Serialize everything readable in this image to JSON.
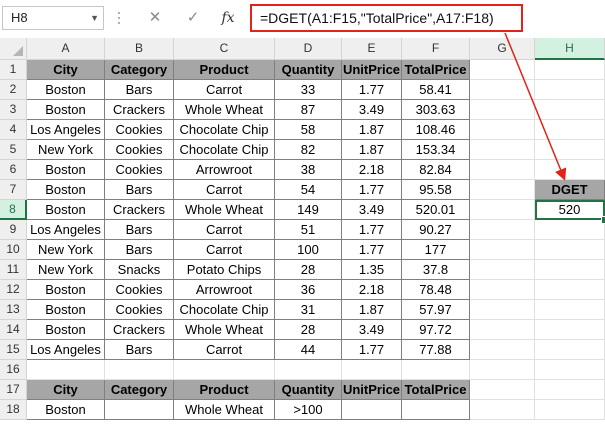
{
  "formula_bar": {
    "name_box": "H8",
    "cancel_icon": "✕",
    "confirm_icon": "✓",
    "fx_label": "fx",
    "formula": "=DGET(A1:F15,\"TotalPrice\",A17:F18)"
  },
  "columns": [
    "A",
    "B",
    "C",
    "D",
    "E",
    "F",
    "G",
    "H"
  ],
  "rows": [
    "1",
    "2",
    "3",
    "4",
    "5",
    "6",
    "7",
    "8",
    "9",
    "10",
    "11",
    "12",
    "13",
    "14",
    "15",
    "16",
    "17",
    "18"
  ],
  "selected": {
    "column": "H",
    "row": "8"
  },
  "accent_colors": {
    "excel_green": "#217346",
    "highlight_red": "#e2231a",
    "header_gray": "#a6a6a6"
  },
  "data_table": {
    "headers": [
      "City",
      "Category",
      "Product",
      "Quantity",
      "UnitPrice",
      "TotalPrice"
    ],
    "rows": [
      [
        "Boston",
        "Bars",
        "Carrot",
        "33",
        "1.77",
        "58.41"
      ],
      [
        "Boston",
        "Crackers",
        "Whole Wheat",
        "87",
        "3.49",
        "303.63"
      ],
      [
        "Los Angeles",
        "Cookies",
        "Chocolate Chip",
        "58",
        "1.87",
        "108.46"
      ],
      [
        "New York",
        "Cookies",
        "Chocolate Chip",
        "82",
        "1.87",
        "153.34"
      ],
      [
        "Boston",
        "Cookies",
        "Arrowroot",
        "38",
        "2.18",
        "82.84"
      ],
      [
        "Boston",
        "Bars",
        "Carrot",
        "54",
        "1.77",
        "95.58"
      ],
      [
        "Boston",
        "Crackers",
        "Whole Wheat",
        "149",
        "3.49",
        "520.01"
      ],
      [
        "Los Angeles",
        "Bars",
        "Carrot",
        "51",
        "1.77",
        "90.27"
      ],
      [
        "New York",
        "Bars",
        "Carrot",
        "100",
        "1.77",
        "177"
      ],
      [
        "New York",
        "Snacks",
        "Potato Chips",
        "28",
        "1.35",
        "37.8"
      ],
      [
        "Boston",
        "Cookies",
        "Arrowroot",
        "36",
        "2.18",
        "78.48"
      ],
      [
        "Boston",
        "Cookies",
        "Chocolate Chip",
        "31",
        "1.87",
        "57.97"
      ],
      [
        "Boston",
        "Crackers",
        "Whole Wheat",
        "28",
        "3.49",
        "97.72"
      ],
      [
        "Los Angeles",
        "Bars",
        "Carrot",
        "44",
        "1.77",
        "77.88"
      ]
    ]
  },
  "criteria_table": {
    "headers": [
      "City",
      "Category",
      "Product",
      "Quantity",
      "UnitPrice",
      "TotalPrice"
    ],
    "row": [
      "Boston",
      "",
      "Whole Wheat",
      ">100",
      "",
      ""
    ]
  },
  "result": {
    "label": "DGET",
    "value": "520"
  }
}
